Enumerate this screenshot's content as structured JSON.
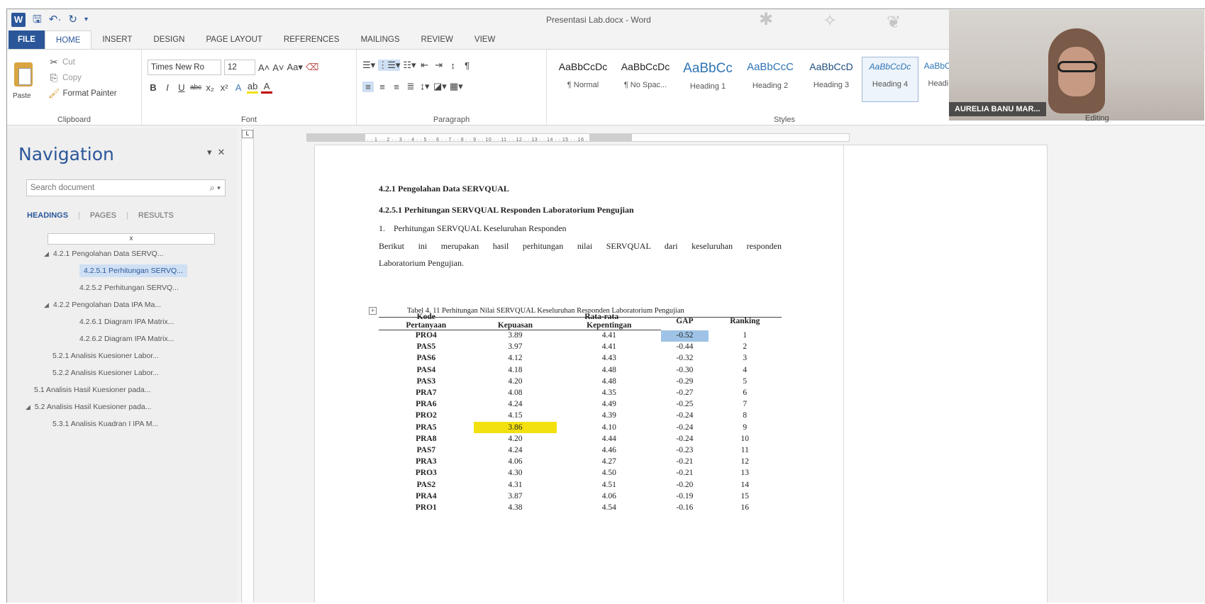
{
  "window": {
    "title": "Presentasi Lab.docx - Word"
  },
  "tabs": [
    "FILE",
    "HOME",
    "INSERT",
    "DESIGN",
    "PAGE LAYOUT",
    "REFERENCES",
    "MAILINGS",
    "REVIEW",
    "VIEW"
  ],
  "active_tab": "HOME",
  "ribbon": {
    "clipboard": {
      "paste": "Paste",
      "cut": "Cut",
      "copy": "Copy",
      "format_painter": "Format Painter",
      "label": "Clipboard"
    },
    "font": {
      "family": "Times New Ro",
      "size": "12",
      "label": "Font"
    },
    "paragraph": {
      "label": "Paragraph"
    },
    "styles": {
      "label": "Styles",
      "items": [
        {
          "preview": "AaBbCcDc",
          "name": "¶ Normal"
        },
        {
          "preview": "AaBbCcDc",
          "name": "¶ No Spac..."
        },
        {
          "preview": "AaBbCc",
          "name": "Heading 1"
        },
        {
          "preview": "AaBbCcC",
          "name": "Heading 2"
        },
        {
          "preview": "AaBbCcD",
          "name": "Heading 3"
        },
        {
          "preview": "AaBbCcDc",
          "name": "Heading 4"
        },
        {
          "preview": "AaBbCcD",
          "name": "Heading"
        }
      ]
    },
    "editing_label": "Editing"
  },
  "webcam": {
    "name": "AURELIA BANU MAR..."
  },
  "navigation": {
    "title": "Navigation",
    "search_placeholder": "Search document",
    "tabs": [
      "HEADINGS",
      "PAGES",
      "RESULTS"
    ],
    "x_box": "x",
    "headings": [
      {
        "text": "4.2.1 Pengolahan Data SERVQ...",
        "level": 1,
        "expander": "◢"
      },
      {
        "text": "4.2.5.1 Perhitungan SERVQ...",
        "level": 2,
        "selected": true
      },
      {
        "text": "4.2.5.2 Perhitungan SERVQ...",
        "level": 2
      },
      {
        "text": "4.2.2 Pengolahan Data IPA Ma...",
        "level": 1,
        "expander": "◢"
      },
      {
        "text": "4.2.6.1 Diagram IPA Matrix...",
        "level": 2
      },
      {
        "text": "4.2.6.2 Diagram IPA Matrix...",
        "level": 2
      },
      {
        "text": "5.2.1 Analisis Kuesioner Labor...",
        "level": 1
      },
      {
        "text": "5.2.2 Analisis Kuesioner Labor...",
        "level": 1
      },
      {
        "text": "5.1 Analisis Hasil Kuesioner pada...",
        "level": 0
      },
      {
        "text": "5.2 Analisis Hasil Kuesioner pada...",
        "level": 0,
        "expander": "◢"
      },
      {
        "text": "5.3.1 Analisis Kuadran I IPA M...",
        "level": 1
      }
    ]
  },
  "document": {
    "h1": "4.2.1 Pengolahan Data SERVQUAL",
    "h2": "4.2.5.1 Perhitungan SERVQUAL Responden Laboratorium Pengujian",
    "list_item": "1.    Perhitungan SERVQUAL Keseluruhan Responden",
    "para_line1": "Berikut ini merupakan hasil perhitungan nilai SERVQUAL dari keseluruhan responden",
    "para_line2": "Laboratorium Pengujian.",
    "caption": "Tabel 4. 11 Perhitungan Nilai SERVQUAL Keseluruhan Responden Laboratorium Pengujian",
    "table": {
      "headers": {
        "kode": "Kode",
        "pertanyaan": "Pertanyaan",
        "rata_rata": "Rata-rata",
        "kepuasan": "Kepuasan",
        "kepentingan": "Kepentingan",
        "gap": "GAP",
        "ranking": "Ranking"
      },
      "rows": [
        [
          "PRO4",
          "3.89",
          "4.41",
          "-0.52",
          "1"
        ],
        [
          "PAS5",
          "3.97",
          "4.41",
          "-0.44",
          "2"
        ],
        [
          "PAS6",
          "4.12",
          "4.43",
          "-0.32",
          "3"
        ],
        [
          "PAS4",
          "4.18",
          "4.48",
          "-0.30",
          "4"
        ],
        [
          "PAS3",
          "4.20",
          "4.48",
          "-0.29",
          "5"
        ],
        [
          "PRA7",
          "4.08",
          "4.35",
          "-0.27",
          "6"
        ],
        [
          "PRA6",
          "4.24",
          "4.49",
          "-0.25",
          "7"
        ],
        [
          "PRO2",
          "4.15",
          "4.39",
          "-0.24",
          "8"
        ],
        [
          "PRA5",
          "3.86",
          "4.10",
          "-0.24",
          "9"
        ],
        [
          "PRA8",
          "4.20",
          "4.44",
          "-0.24",
          "10"
        ],
        [
          "PAS7",
          "4.24",
          "4.46",
          "-0.23",
          "11"
        ],
        [
          "PRA3",
          "4.06",
          "4.27",
          "-0.21",
          "12"
        ],
        [
          "PRO3",
          "4.30",
          "4.50",
          "-0.21",
          "13"
        ],
        [
          "PAS2",
          "4.31",
          "4.51",
          "-0.20",
          "14"
        ],
        [
          "PRA4",
          "3.87",
          "4.06",
          "-0.19",
          "15"
        ],
        [
          "PRO1",
          "4.38",
          "4.54",
          "-0.16",
          "16"
        ]
      ]
    }
  }
}
